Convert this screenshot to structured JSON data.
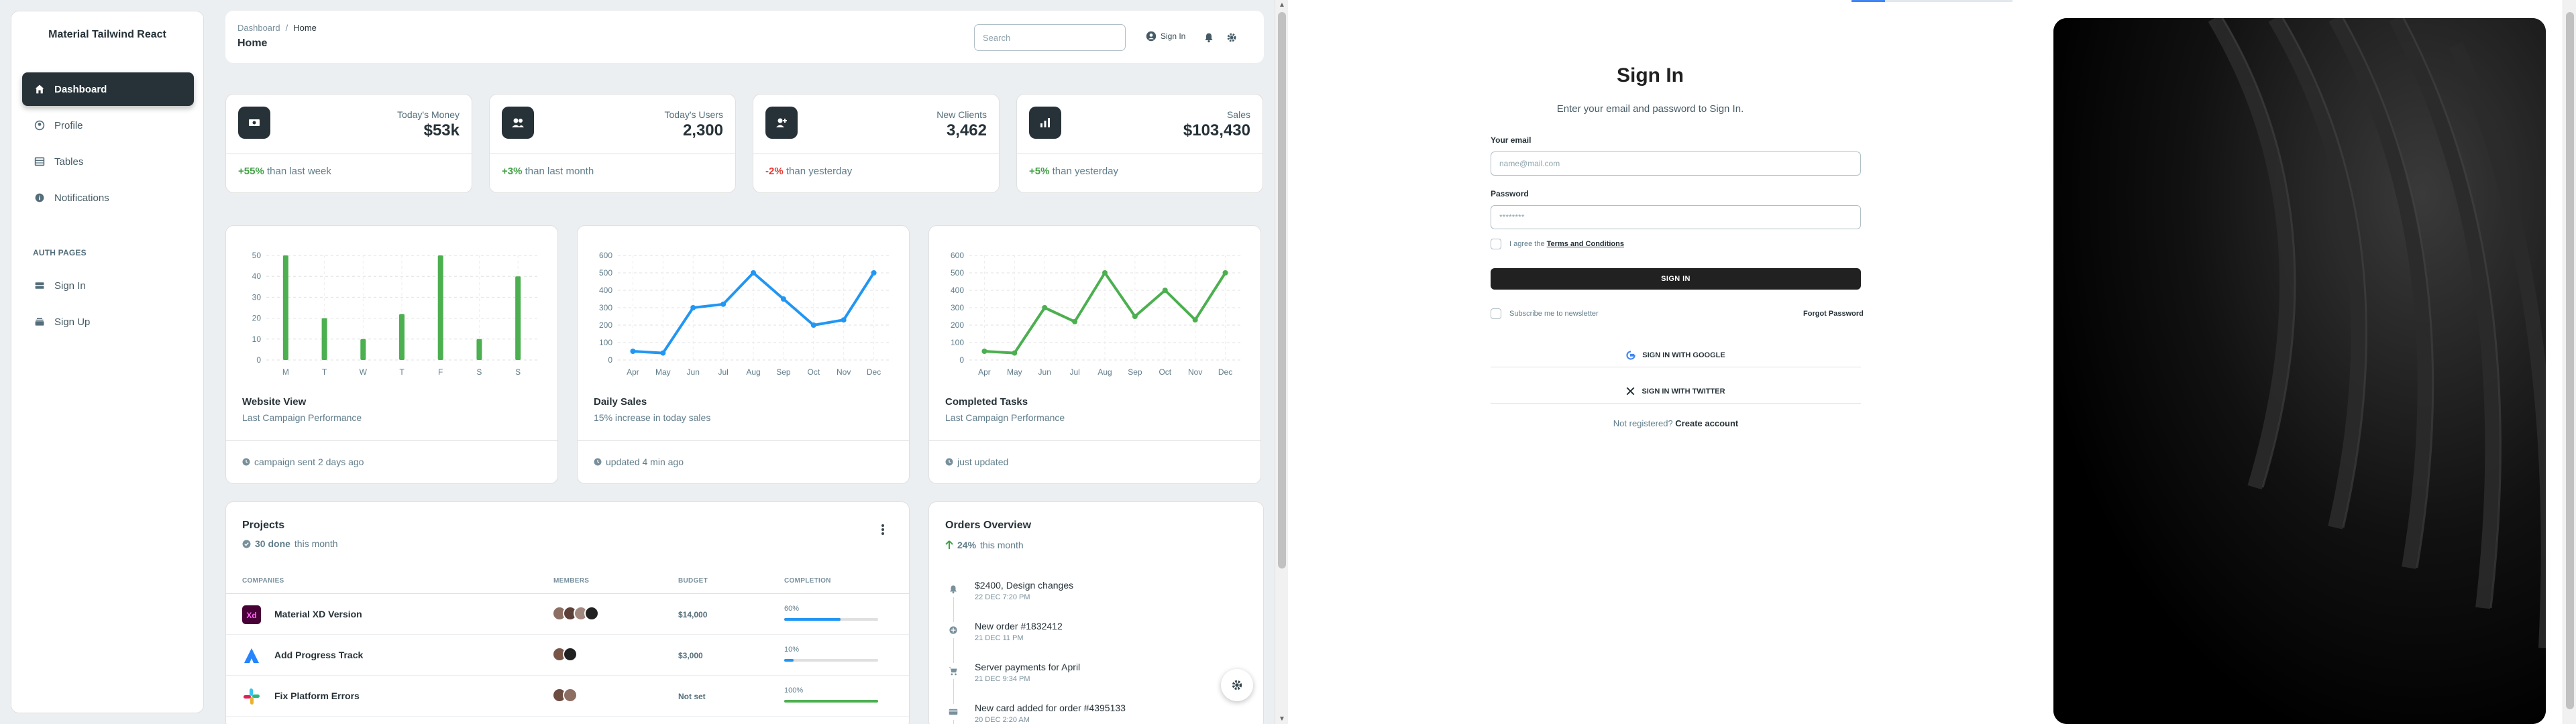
{
  "sidebar": {
    "brand": "Material Tailwind React",
    "items": [
      {
        "label": "Dashboard",
        "icon": "home-icon"
      },
      {
        "label": "Profile",
        "icon": "user-circle-icon"
      },
      {
        "label": "Tables",
        "icon": "table-icon"
      },
      {
        "label": "Notifications",
        "icon": "info-icon"
      }
    ],
    "auth_heading": "AUTH PAGES",
    "auth_items": [
      {
        "label": "Sign In",
        "icon": "server-stack-icon"
      },
      {
        "label": "Sign Up",
        "icon": "rectangle-stack-icon"
      }
    ]
  },
  "topbar": {
    "breadcrumb_root": "Dashboard",
    "breadcrumb_sep": "/",
    "breadcrumb_current": "Home",
    "title": "Home",
    "search_placeholder": "Search",
    "signin_label": "Sign In"
  },
  "stats": [
    {
      "label": "Today's Money",
      "value": "$53k",
      "change": "+55%",
      "change_type": "pos",
      "footer": "than last week",
      "icon": "banknotes-icon"
    },
    {
      "label": "Today's Users",
      "value": "2,300",
      "change": "+3%",
      "change_type": "pos",
      "footer": "than last month",
      "icon": "users-icon"
    },
    {
      "label": "New Clients",
      "value": "3,462",
      "change": "-2%",
      "change_type": "neg",
      "footer": "than yesterday",
      "icon": "user-plus-icon"
    },
    {
      "label": "Sales",
      "value": "$103,430",
      "change": "+5%",
      "change_type": "pos",
      "footer": "than yesterday",
      "icon": "chart-bar-icon"
    }
  ],
  "chart_cards": [
    {
      "title": "Website View",
      "subtitle": "Last Campaign Performance",
      "footer": "campaign sent 2 days ago"
    },
    {
      "title": "Daily Sales",
      "subtitle": "15% increase in today sales",
      "footer": "updated 4 min ago"
    },
    {
      "title": "Completed Tasks",
      "subtitle": "Last Campaign Performance",
      "footer": "just updated"
    }
  ],
  "chart_data": [
    {
      "type": "bar",
      "title": "Website View",
      "categories": [
        "M",
        "T",
        "W",
        "T",
        "F",
        "S",
        "S"
      ],
      "values": [
        50,
        20,
        10,
        22,
        50,
        10,
        40
      ],
      "yticks": [
        0,
        10,
        20,
        30,
        40,
        50
      ],
      "ylim": [
        0,
        50
      ],
      "color": "#4caf50",
      "grid": true
    },
    {
      "type": "line",
      "title": "Daily Sales",
      "categories": [
        "Apr",
        "May",
        "Jun",
        "Jul",
        "Aug",
        "Sep",
        "Oct",
        "Nov",
        "Dec"
      ],
      "values": [
        50,
        40,
        300,
        320,
        500,
        350,
        200,
        230,
        500
      ],
      "yticks": [
        0,
        100,
        200,
        300,
        400,
        500,
        600
      ],
      "ylim": [
        0,
        600
      ],
      "color": "#2196f3",
      "grid": true
    },
    {
      "type": "line",
      "title": "Completed Tasks",
      "categories": [
        "Apr",
        "May",
        "Jun",
        "Jul",
        "Aug",
        "Sep",
        "Oct",
        "Nov",
        "Dec"
      ],
      "values": [
        50,
        40,
        300,
        220,
        500,
        250,
        400,
        230,
        500
      ],
      "yticks": [
        0,
        100,
        200,
        300,
        400,
        500,
        600
      ],
      "ylim": [
        0,
        600
      ],
      "color": "#4caf50",
      "grid": true
    }
  ],
  "projects": {
    "title": "Projects",
    "done_count": "30 done",
    "done_suffix": "this month",
    "columns": [
      "COMPANIES",
      "MEMBERS",
      "BUDGET",
      "COMPLETION"
    ],
    "rows": [
      {
        "name": "Material XD Version",
        "budget": "$14,000",
        "completion": "60%",
        "completion_value": 0.6,
        "color": "#2196f3",
        "logo": "xd-logo-icon"
      },
      {
        "name": "Add Progress Track",
        "budget": "$3,000",
        "completion": "10%",
        "completion_value": 0.1,
        "color": "#2196f3",
        "logo": "atlassian-logo-icon"
      },
      {
        "name": "Fix Platform Errors",
        "budget": "Not set",
        "completion": "100%",
        "completion_value": 1.0,
        "color": "#4caf50",
        "logo": "slack-logo-icon"
      }
    ]
  },
  "orders": {
    "title": "Orders Overview",
    "change": "24%",
    "change_suffix": "this month",
    "items": [
      {
        "title": "$2400, Design changes",
        "date": "22 DEC 7:20 PM",
        "icon": "bell-icon"
      },
      {
        "title": "New order #1832412",
        "date": "21 DEC 11 PM",
        "icon": "plus-circle-icon"
      },
      {
        "title": "Server payments for April",
        "date": "21 DEC 9:34 PM",
        "icon": "shopping-cart-icon"
      },
      {
        "title": "New card added for order #4395133",
        "date": "20 DEC 2:20 AM",
        "icon": "credit-card-icon"
      }
    ]
  },
  "signin": {
    "title": "Sign In",
    "subtitle": "Enter your email and password to Sign In.",
    "email_label": "Your email",
    "email_placeholder": "name@mail.com",
    "password_label": "Password",
    "password_placeholder": "********",
    "agree_prefix": "I agree the",
    "agree_link": "Terms and Conditions",
    "button": "SIGN IN",
    "subscribe": "Subscribe me to newsletter",
    "forgot": "Forgot Password",
    "google": "SIGN IN WITH GOOGLE",
    "twitter": "SIGN IN WITH TWITTER",
    "not_registered": "Not registered?",
    "create_account": "Create account"
  }
}
